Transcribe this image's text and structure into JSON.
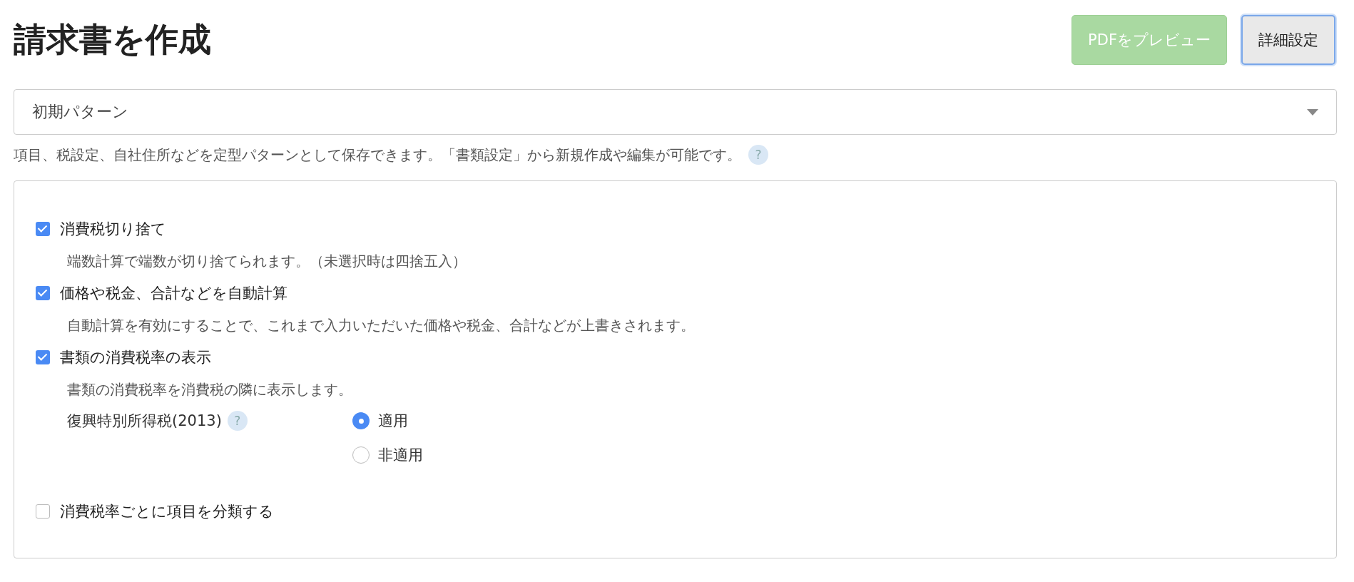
{
  "title": "請求書を作成",
  "buttons": [
    {
      "label": "PDFをプレビュー",
      "disabled": true
    },
    {
      "label": "詳細設定",
      "disabled": false
    }
  ],
  "pattern_select": {
    "value": "初期パターン"
  },
  "help_text": "項目、税設定、自社住所などを定型パターンとして保存できます。「書類設定」から新規作成や編集が可能です。",
  "help_icon": "?",
  "options": [
    {
      "kind": "checkbox",
      "label": "消費税切り捨て",
      "checked": true,
      "description": "端数計算で端数が切り捨てられます。（未選択時は四捨五入）"
    },
    {
      "kind": "checkbox",
      "label": "価格や税金、合計などを自動計算",
      "checked": true,
      "description": "自動計算を有効にすることで、これまで入力いただいた価格や税金、合計などが上書きされます。"
    },
    {
      "kind": "checkbox",
      "label": "書類の消費税率の表示",
      "checked": true,
      "description": "書類の消費税率を消費税の隣に表示します。"
    },
    {
      "kind": "radio_group",
      "label": "復興特別所得税(2013)",
      "help_icon": "?",
      "choices": [
        {
          "label": "適用",
          "selected": true
        },
        {
          "label": "非適用",
          "selected": false
        }
      ]
    },
    {
      "kind": "checkbox",
      "label": "消費税率ごとに項目を分類する",
      "checked": false
    }
  ]
}
